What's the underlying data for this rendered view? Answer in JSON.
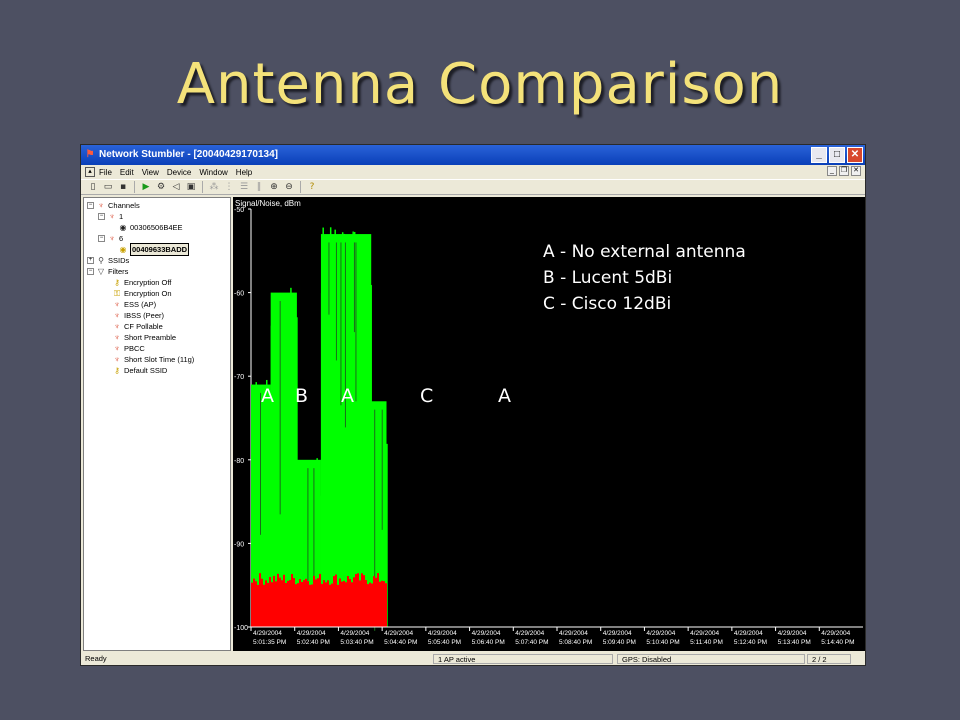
{
  "slide": {
    "title": "Antenna Comparison"
  },
  "window": {
    "title": "Network Stumbler - [20040429170134]",
    "controls": [
      "minimize",
      "maximize",
      "close"
    ]
  },
  "menu": [
    "File",
    "Edit",
    "View",
    "Device",
    "Window",
    "Help"
  ],
  "toolbar_icons": [
    "new-icon",
    "open-icon",
    "save-icon",
    "play-icon",
    "scan-icon",
    "sound-icon",
    "config-icon",
    "filter-icon",
    "filter2-icon",
    "list-icon",
    "bars-icon",
    "zoom-in-icon",
    "zoom-out-icon",
    "help-icon"
  ],
  "tree": {
    "channels": "Channels",
    "ch1": "1",
    "ch1_ap": "00306506B4EE",
    "ch6": "6",
    "ch6_ap": "00409633BADD",
    "ssids": "SSIDs",
    "filters": "Filters",
    "filter_items": [
      "Encryption Off",
      "Encryption On",
      "ESS (AP)",
      "IBSS (Peer)",
      "CF Pollable",
      "Short Preamble",
      "PBCC",
      "Short Slot Time (11g)",
      "Default SSID"
    ]
  },
  "chart_data": {
    "type": "area",
    "title": "Signal/Noise, dBm",
    "ylim": [
      -100,
      -50
    ],
    "yticks": [
      "-50",
      "-60",
      "-70",
      "-80",
      "-90",
      "-100"
    ],
    "xticks": [
      {
        "date": "4/29/2004",
        "time": "5:01:35 PM"
      },
      {
        "date": "4/29/2004",
        "time": "5:02:40 PM"
      },
      {
        "date": "4/29/2004",
        "time": "5:03:40 PM"
      },
      {
        "date": "4/29/2004",
        "time": "5:04:40 PM"
      },
      {
        "date": "4/29/2004",
        "time": "5:05:40 PM"
      },
      {
        "date": "4/29/2004",
        "time": "5:06:40 PM"
      },
      {
        "date": "4/29/2004",
        "time": "5:07:40 PM"
      },
      {
        "date": "4/29/2004",
        "time": "5:08:40 PM"
      },
      {
        "date": "4/29/2004",
        "time": "5:09:40 PM"
      },
      {
        "date": "4/29/2004",
        "time": "5:10:40 PM"
      },
      {
        "date": "4/29/2004",
        "time": "5:11:40 PM"
      },
      {
        "date": "4/29/2004",
        "time": "5:12:40 PM"
      },
      {
        "date": "4/29/2004",
        "time": "5:13:40 PM"
      },
      {
        "date": "4/29/2004",
        "time": "5:14:40 PM"
      }
    ],
    "series": [
      {
        "name": "Signal",
        "color": "#00ff00"
      },
      {
        "name": "Noise",
        "color": "#ff0000"
      }
    ],
    "segments": [
      {
        "label": "A",
        "start": 0.0,
        "end": 0.45,
        "level": -74
      },
      {
        "label": "B",
        "start": 0.45,
        "end": 1.05,
        "level": -63
      },
      {
        "label": "A",
        "start": 1.05,
        "end": 1.6,
        "level": -83
      },
      {
        "label": "C",
        "start": 1.6,
        "end": 2.75,
        "level": -56
      },
      {
        "label": "A",
        "start": 2.75,
        "end": 3.1,
        "level": -76
      }
    ],
    "noise_level": -95,
    "segment_labels": [
      "A",
      "B",
      "A",
      "C",
      "A"
    ],
    "legend": [
      "A - No external antenna",
      "B - Lucent 5dBi",
      "C - Cisco 12dBi"
    ]
  },
  "status": {
    "ready": "Ready",
    "ap": "1 AP active",
    "gps": "GPS: Disabled",
    "page": "2 / 2"
  }
}
